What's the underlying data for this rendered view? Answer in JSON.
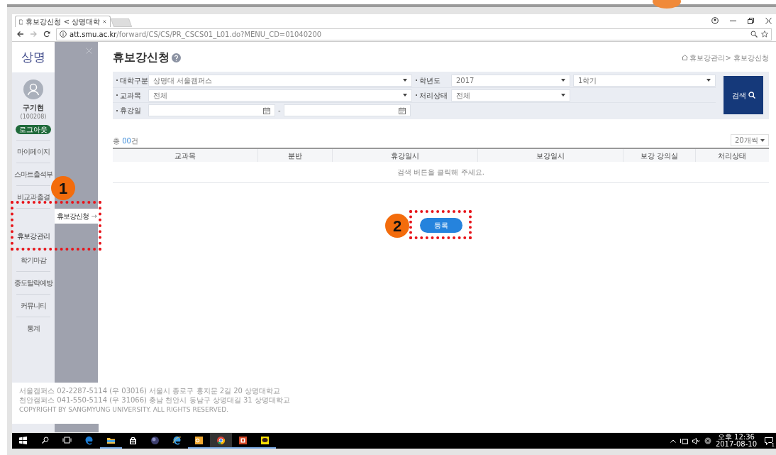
{
  "browser": {
    "tab_title": "휴보강신청 < 상명대학",
    "url_host": "att.smu.ac.kr",
    "url_path": "/forward/CS/CS/PR_CSCS01_L01.do?MENU_CD=01040200"
  },
  "sidebar": {
    "logo": "상명",
    "user_name": "구기현",
    "user_id": "(100208)",
    "logout": "로그아웃",
    "menu": [
      {
        "label": "마이페이지",
        "selected": false
      },
      {
        "label": "스마트출석부",
        "selected": false
      },
      {
        "label": "비교과출결",
        "selected": false
      },
      {
        "label": "휴보강관리",
        "selected": true
      },
      {
        "label": "학기마감",
        "selected": false
      },
      {
        "label": "중도탈락예방",
        "selected": false
      },
      {
        "label": "커뮤니티",
        "selected": false
      },
      {
        "label": "통계",
        "selected": false
      }
    ],
    "submenu": [
      {
        "label": "휴보강신청",
        "arrow": "→"
      }
    ]
  },
  "page": {
    "title": "휴보강신청",
    "breadcrumb": "휴보강관리> 휴보강신청"
  },
  "filter_rows": [
    {
      "groups": [
        {
          "label": "대학구분",
          "fields": [
            {
              "kind": "select",
              "value": "상명대 서울캠퍼스"
            }
          ]
        },
        {
          "label": "학년도",
          "fields": [
            {
              "kind": "select",
              "value": "2017"
            },
            {
              "kind": "select",
              "value": "1학기"
            }
          ]
        }
      ]
    },
    {
      "groups": [
        {
          "label": "교과목",
          "fields": [
            {
              "kind": "select",
              "value": "전체"
            }
          ]
        },
        {
          "label": "처리상태",
          "fields": [
            {
              "kind": "select",
              "value": "전체"
            }
          ]
        }
      ]
    },
    {
      "groups": [
        {
          "label": "휴강일",
          "fields": [
            {
              "kind": "date"
            },
            {
              "kind": "separator",
              "text": "-"
            },
            {
              "kind": "date"
            }
          ]
        }
      ]
    }
  ],
  "search_button": "검색",
  "total": {
    "prefix": "총 ",
    "count": "00",
    "suffix": "건"
  },
  "page_size": "20개씩",
  "table": {
    "columns": [
      "교과목",
      "분반",
      "휴강일시",
      "보강일시",
      "보강 강의실",
      "처리상태"
    ],
    "empty_message": "검색 버튼을 클릭해 주세요."
  },
  "register_button": "등록",
  "footer": [
    "서울캠퍼스 02-2287-5114 (우 03016) 서울시 종로구 홍지문 2길 20 상명대학교",
    "천안캠퍼스 041-550-5114 (우 31066) 충남 천안시 동남구 상명대길 31 상명대학교",
    "COPYRIGHT BY SANGMYUNG UNIVERSITY. ALL RIGHTS RESERVED."
  ],
  "taskbar": {
    "apps": [
      {
        "kind": "edge",
        "running": false,
        "selected": false
      },
      {
        "kind": "explorer",
        "running": true,
        "selected": false
      },
      {
        "kind": "store",
        "running": false,
        "selected": false
      },
      {
        "kind": "globe",
        "running": false,
        "selected": false
      },
      {
        "kind": "ie",
        "running": false,
        "selected": false
      },
      {
        "kind": "mail",
        "running": true,
        "selected": false
      },
      {
        "kind": "chrome",
        "running": true,
        "selected": true
      },
      {
        "kind": "slides",
        "running": true,
        "selected": false
      },
      {
        "kind": "chat",
        "running": true,
        "selected": false
      }
    ],
    "time": "오후 12:36",
    "date": "2017-08-10",
    "notification_count": "1"
  },
  "annotations": [
    {
      "number": "1"
    },
    {
      "number": "2"
    }
  ]
}
